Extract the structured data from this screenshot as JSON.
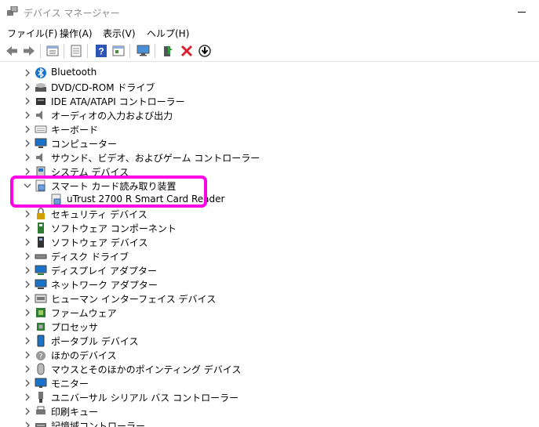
{
  "window": {
    "title": "デバイス マネージャー"
  },
  "menu": [
    {
      "label": "ファイル(F)"
    },
    {
      "label": "操作(A)"
    },
    {
      "label": "表示(V)"
    },
    {
      "label": "ヘルプ(H)"
    }
  ],
  "toolbar_icons": [
    "back-icon",
    "forward-icon",
    "properties-icon",
    "update-list-icon",
    "help-icon",
    "properties-sheet-icon",
    "monitor-scan-icon",
    "update-driver-icon",
    "uninstall-icon",
    "download-icon"
  ],
  "tree": [
    {
      "label": "Bluetooth",
      "icon": "bluetooth-icon"
    },
    {
      "label": "DVD/CD-ROM ドライブ",
      "icon": "dvd-drive-icon"
    },
    {
      "label": "IDE ATA/ATAPI コントローラー",
      "icon": "ide-controller-icon"
    },
    {
      "label": "オーディオの入力および出力",
      "icon": "speaker-icon"
    },
    {
      "label": "キーボード",
      "icon": "keyboard-icon"
    },
    {
      "label": "コンピューター",
      "icon": "computer-icon"
    },
    {
      "label": "サウンド、ビデオ、およびゲーム コントローラー",
      "icon": "speaker-icon"
    },
    {
      "label": "システム デバイス",
      "icon": "system-device-icon"
    },
    {
      "label": "スマート カード読み取り装置",
      "icon": "smart-card-reader-icon",
      "expanded": true,
      "children": [
        {
          "label": "uTrust 2700 R Smart Card Reader",
          "icon": "smart-card-reader-icon"
        }
      ]
    },
    {
      "label": "セキュリティ デバイス",
      "icon": "security-device-icon"
    },
    {
      "label": "ソフトウェア コンポーネント",
      "icon": "software-component-icon"
    },
    {
      "label": "ソフトウェア デバイス",
      "icon": "software-device-icon"
    },
    {
      "label": "ディスク ドライブ",
      "icon": "disk-drive-icon"
    },
    {
      "label": "ディスプレイ アダプター",
      "icon": "display-adapter-icon"
    },
    {
      "label": "ネットワーク アダプター",
      "icon": "network-adapter-icon"
    },
    {
      "label": "ヒューマン インターフェイス デバイス",
      "icon": "hid-icon"
    },
    {
      "label": "ファームウェア",
      "icon": "firmware-icon"
    },
    {
      "label": "プロセッサ",
      "icon": "processor-icon"
    },
    {
      "label": "ポータブル デバイス",
      "icon": "portable-device-icon"
    },
    {
      "label": "ほかのデバイス",
      "icon": "unknown-device-icon"
    },
    {
      "label": "マウスとそのほかのポインティング デバイス",
      "icon": "mouse-icon"
    },
    {
      "label": "モニター",
      "icon": "monitor-icon"
    },
    {
      "label": "ユニバーサル シリアル バス コントローラー",
      "icon": "usb-icon"
    },
    {
      "label": "印刷キュー",
      "icon": "print-queue-icon"
    },
    {
      "label": "記憶域コントローラー",
      "icon": "storage-controller-icon"
    }
  ],
  "colors": {
    "highlight": "#ff00e6",
    "accent": "#1a73c7"
  }
}
